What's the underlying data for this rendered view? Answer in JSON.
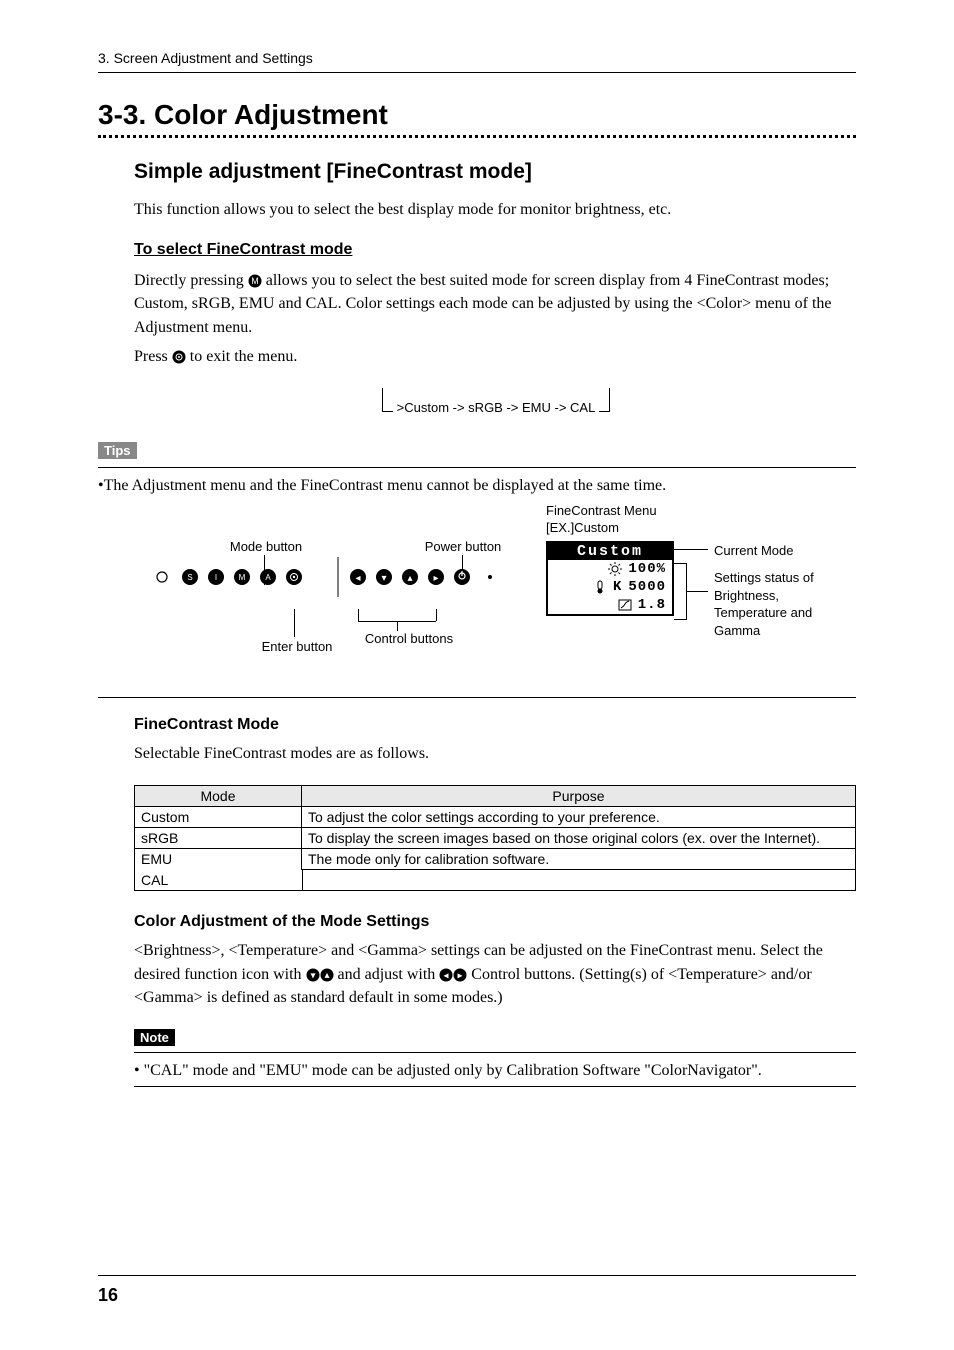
{
  "breadcrumb": "3. Screen Adjustment and Settings",
  "h1": "3-3. Color Adjustment",
  "h2_simple": "Simple adjustment [FineContrast mode]",
  "p_simple": "This function allows you to select the best display mode for monitor brightness, etc.",
  "h3_select": "To select FineContrast mode",
  "p_select_a": "Directly pressing ",
  "p_select_b": " allows you to select the best suited mode for screen display from 4 FineContrast modes; Custom, sRGB, EMU and CAL. Color settings each mode can be adjusted by using the <Color> menu of the Adjustment menu.",
  "p_press_a": "Press ",
  "p_press_b": " to exit the menu.",
  "cycle_text": ">Custom -> sRGB -> EMU -> CAL",
  "tips_label": "Tips",
  "tips_body": "•The Adjustment menu and the FineContrast menu cannot be displayed at the same time.",
  "diagram": {
    "mode_button": "Mode button",
    "power_button": "Power button",
    "enter_button": "Enter button",
    "control_buttons": "Control buttons",
    "fc_menu_title": "FineContrast Menu",
    "fc_menu_sub": "[EX.]Custom",
    "current_mode_label": "Current Mode",
    "settings_label": "Settings status of Brightness, Temperature and Gamma",
    "osd_mode": "Custom",
    "osd_bright": "100%",
    "osd_temp": "5000",
    "osd_temp_unit": "K",
    "osd_gamma": "1.8"
  },
  "h3_fcmode": "FineContrast Mode",
  "p_fcmode": "Selectable FineContrast modes are as follows.",
  "table": {
    "hdr_mode": "Mode",
    "hdr_purpose": "Purpose",
    "rows": [
      {
        "mode": "Custom",
        "purpose": "To adjust the color settings according to your preference."
      },
      {
        "mode": "sRGB",
        "purpose": "To display the screen images based on those original colors (ex. over the Internet)."
      },
      {
        "mode": "EMU",
        "purpose": "The mode only for calibration software."
      },
      {
        "mode": "CAL",
        "purpose": ""
      }
    ]
  },
  "h3_coloradj": "Color Adjustment of the Mode Settings",
  "p_coloradj_a": "<Brightness>, <Temperature> and <Gamma> settings can be adjusted on the FineContrast menu. Select the desired function icon with ",
  "p_coloradj_b": " and adjust with ",
  "p_coloradj_c": " Control buttons. (Setting(s) of <Temperature> and/or <Gamma> is defined as standard default in some modes.)",
  "note_label": "Note",
  "note_body": "•  \"CAL\" mode and \"EMU\" mode can be adjusted only by Calibration Software \"ColorNavigator\".",
  "page_num": "16"
}
